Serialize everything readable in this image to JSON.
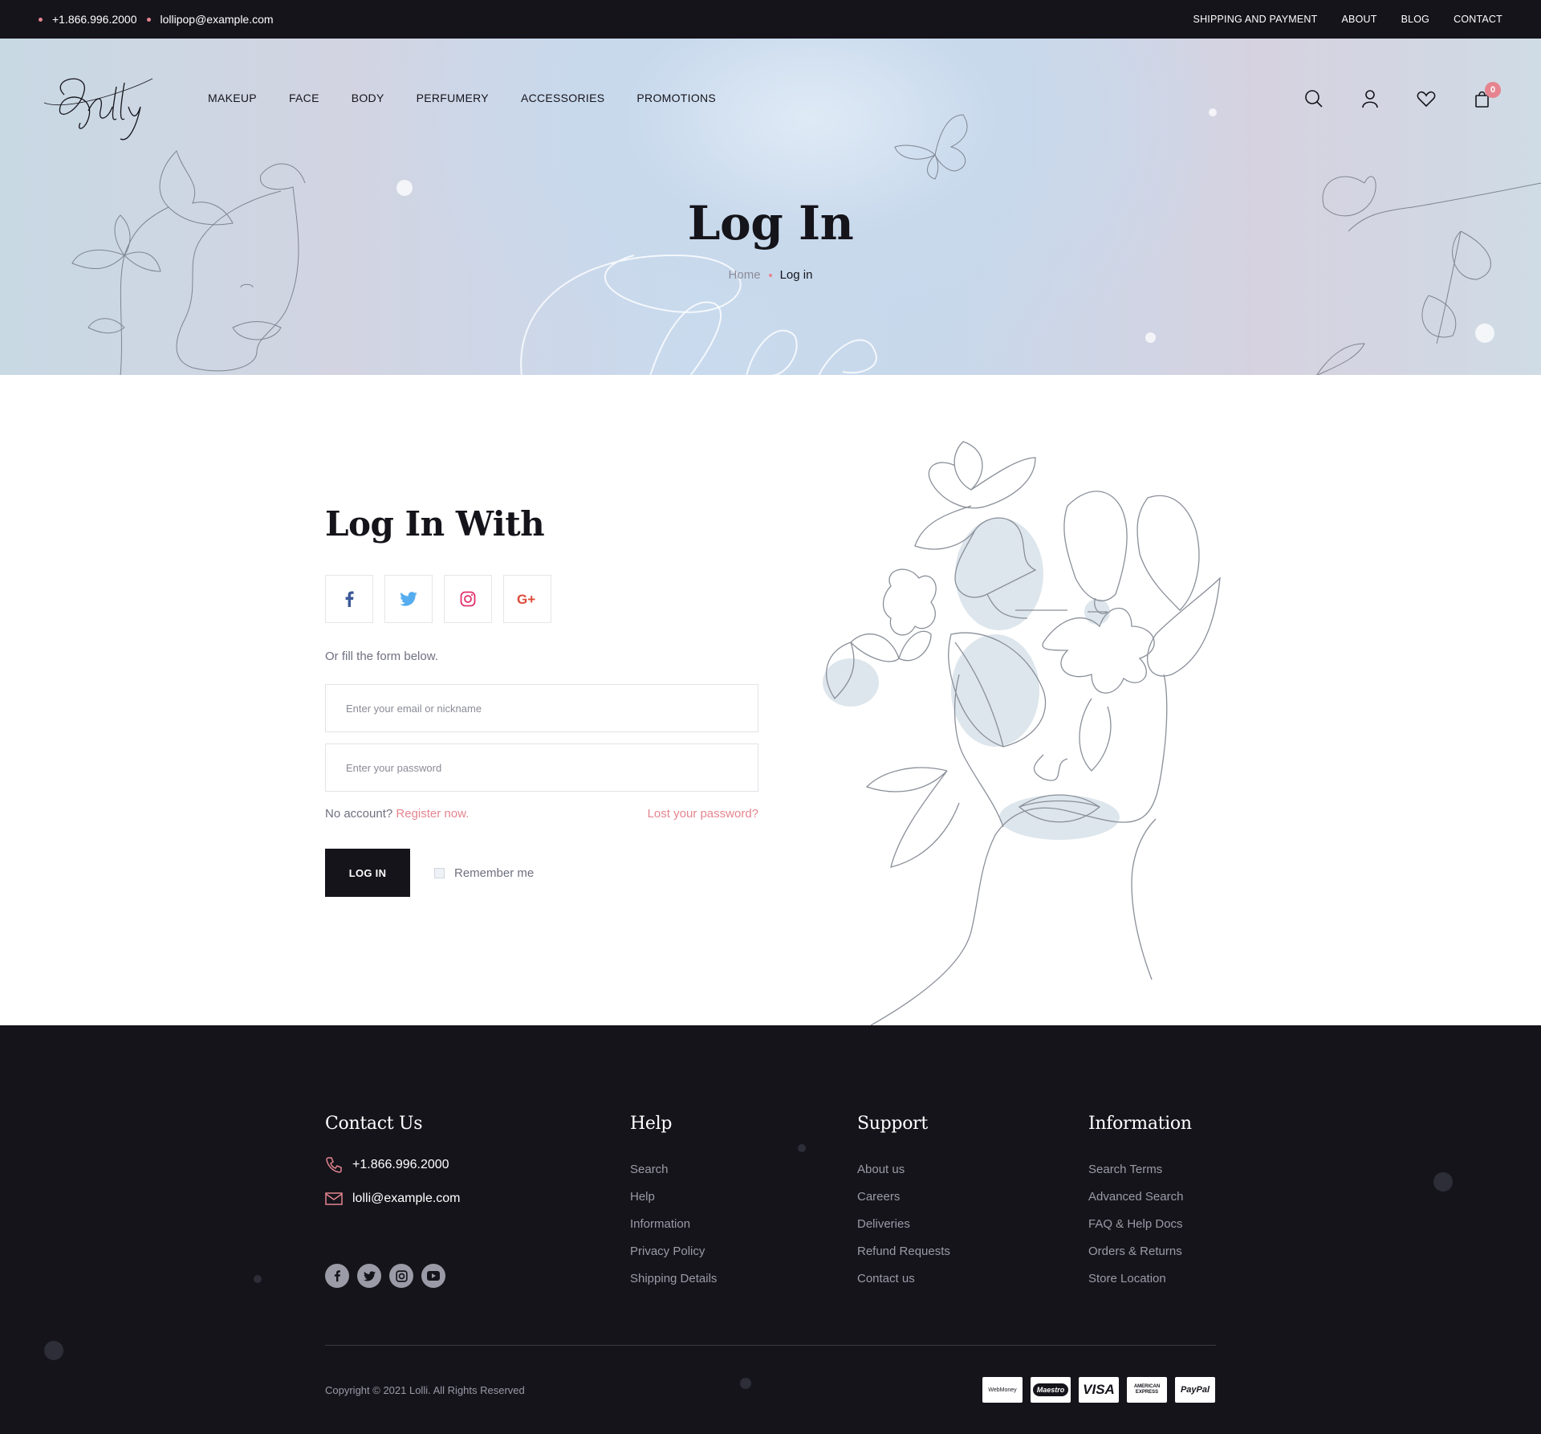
{
  "topbar": {
    "phone": "+1.866.996.2000",
    "email": "lollipop@example.com",
    "links": [
      "SHIPPING AND PAYMENT",
      "ABOUT",
      "BLOG",
      "CONTACT"
    ]
  },
  "header": {
    "nav": [
      "MAKEUP",
      "FACE",
      "BODY",
      "PERFUMERY",
      "ACCESSORIES",
      "PROMOTIONS"
    ],
    "icons": [
      "search-icon",
      "user-icon",
      "heart-icon",
      "cart-icon"
    ],
    "cart_count": "0"
  },
  "hero": {
    "title": "Log In",
    "breadcrumb": {
      "home": "Home",
      "current": "Log in"
    }
  },
  "login": {
    "title": "Log In With",
    "social_icons": [
      "facebook-icon",
      "twitter-icon",
      "instagram-icon",
      "google-plus-icon"
    ],
    "or_text": "Or fill the form below.",
    "email_placeholder": "Enter your email or nickname",
    "email_value": "",
    "password_placeholder": "Enter your password",
    "password_value": "",
    "no_account": "No account?",
    "register": "Register now.",
    "lost_password": "Lost your password?",
    "login_button": "LOG IN",
    "remember": "Remember me",
    "remember_checked": false
  },
  "footer": {
    "contact": {
      "title": "Contact Us",
      "phone": "+1.866.996.2000",
      "email": "lolli@example.com"
    },
    "help": {
      "title": "Help",
      "links": [
        "Search",
        "Help",
        "Information",
        "Privacy Policy",
        "Shipping Details"
      ]
    },
    "support": {
      "title": "Support",
      "links": [
        "About us",
        "Careers",
        "Deliveries",
        "Refund Requests",
        "Contact us"
      ]
    },
    "information": {
      "title": "Information",
      "links": [
        "Search Terms",
        "Advanced Search",
        "FAQ & Help Docs",
        "Orders & Returns",
        "Store Location"
      ]
    },
    "social_icons": [
      "facebook-icon",
      "twitter-icon",
      "instagram-icon",
      "youtube-icon"
    ],
    "copyright": "Copyright © 2021 Lolli.  All Rights Reserved",
    "payments": [
      "WebMoney",
      "Maestro",
      "VISA",
      "AMERICAN EXPRESS",
      "PayPal"
    ]
  },
  "colors": {
    "dark": "#15141b",
    "accent": "#e5848f",
    "muted": "#9a9ba6"
  }
}
